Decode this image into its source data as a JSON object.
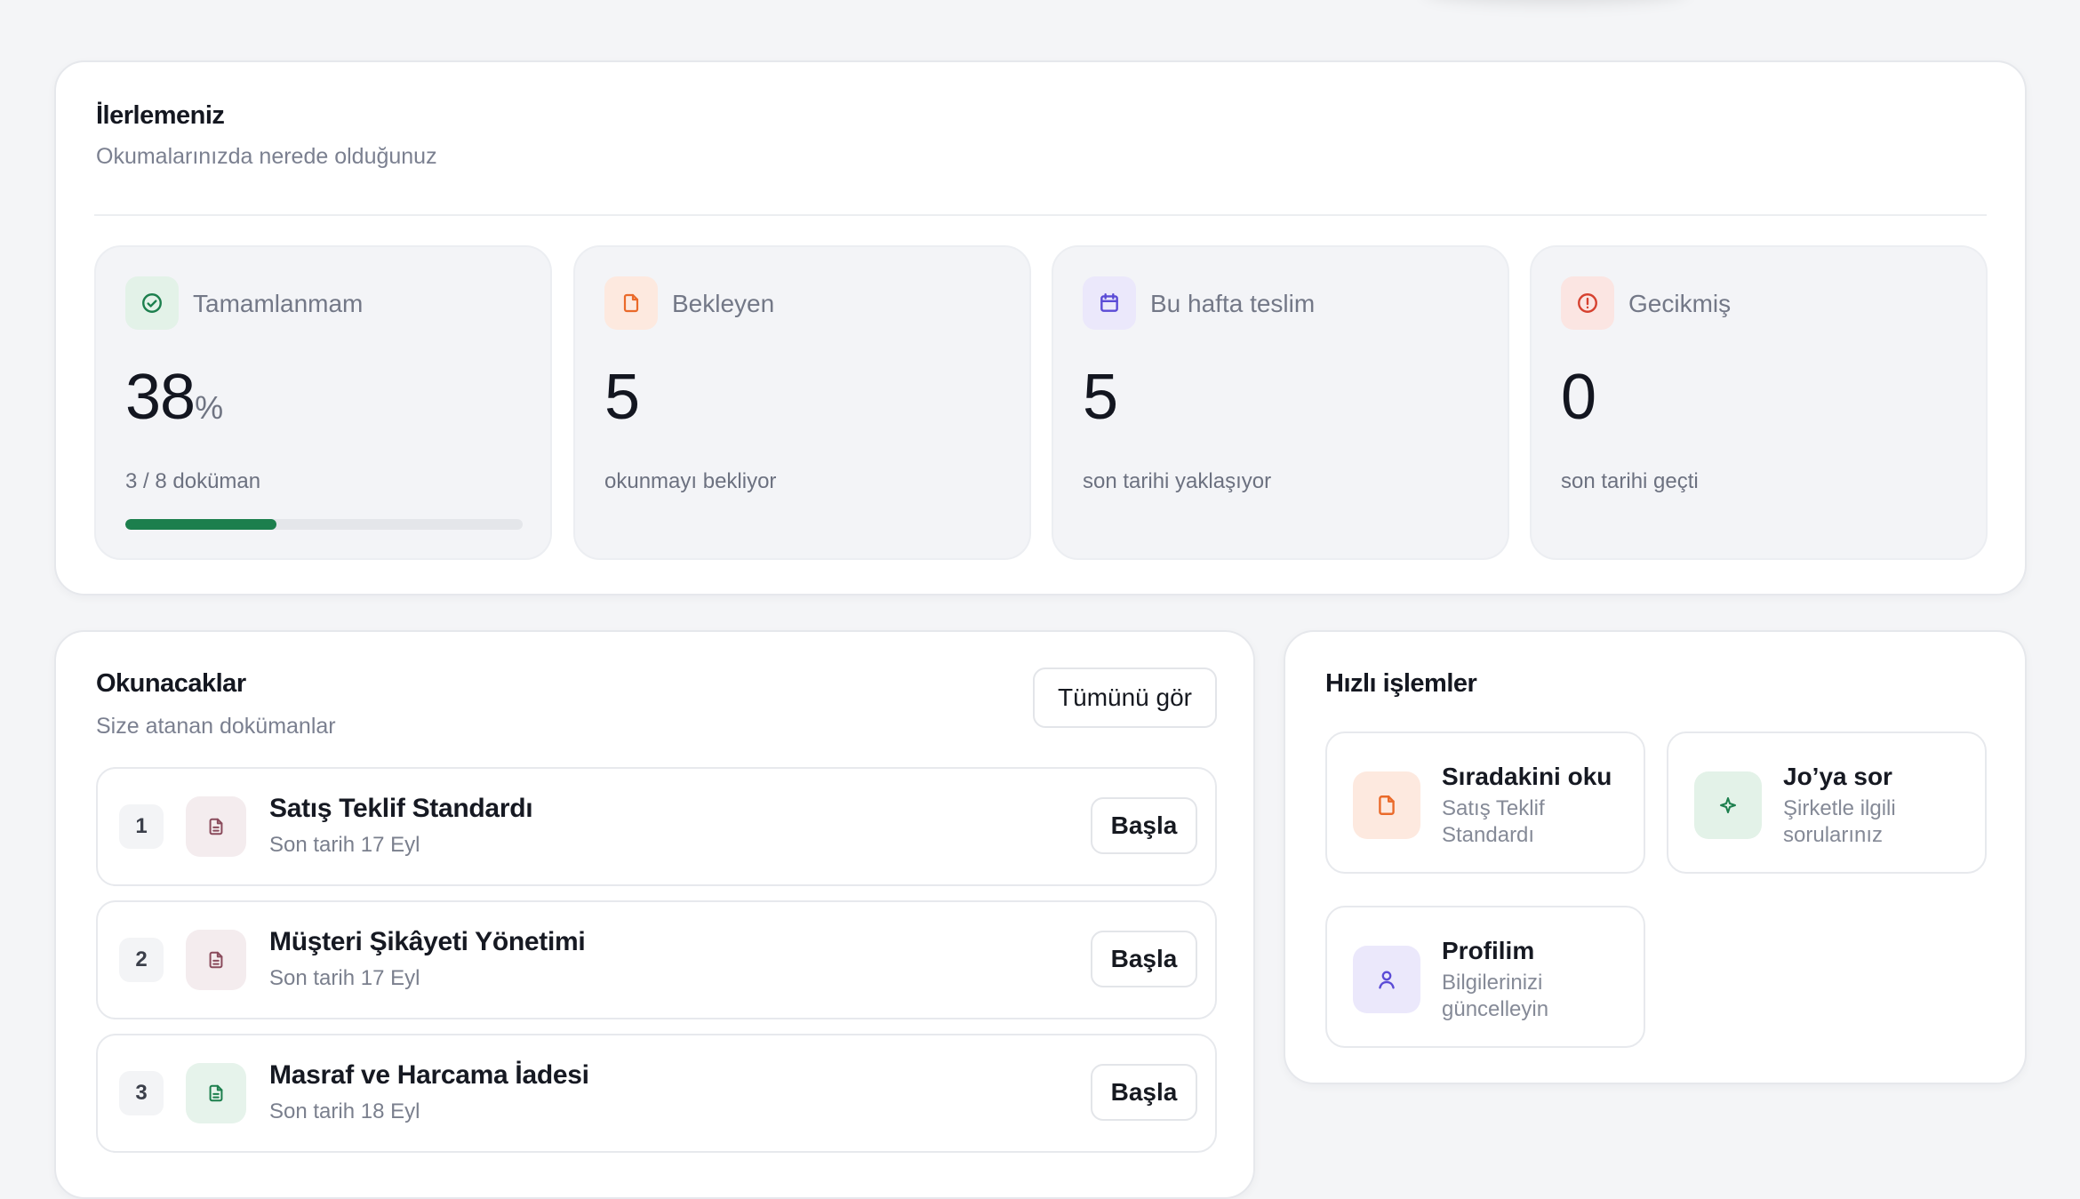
{
  "progress": {
    "title": "İlerlemeniz",
    "subtitle": "Okumalarınızda nerede olduğunuz",
    "stats": [
      {
        "label": "Tamamlanmam",
        "value": "38",
        "unit": "%",
        "note": "3 / 8 doküman",
        "icon": "check-circle-icon",
        "color": "#1c7f4d",
        "progress": 0.38
      },
      {
        "label": "Bekleyen",
        "value": "5",
        "note": "okunmayı bekliyor",
        "icon": "document-icon",
        "color": "#ea6a2a"
      },
      {
        "label": "Bu hafta teslim",
        "value": "5",
        "note": "son tarihi yaklaşıyor",
        "icon": "calendar-icon",
        "color": "#5b4bd6"
      },
      {
        "label": "Gecikmiş",
        "value": "0",
        "note": "son tarihi geçti",
        "icon": "alert-circle-icon",
        "color": "#d6412f"
      }
    ]
  },
  "reading": {
    "title": "Okunacaklar",
    "subtitle": "Size atanan dokümanlar",
    "see_all": "Tümünü gör",
    "items": [
      {
        "num": "1",
        "title": "Satış Teklif Standardı",
        "due": "Son tarih 17 Eyl",
        "action": "Başla",
        "icon": "document-text-icon",
        "color": "#8a4b5c"
      },
      {
        "num": "2",
        "title": "Müşteri Şikâyeti Yönetimi",
        "due": "Son tarih 17 Eyl",
        "action": "Başla",
        "icon": "document-text-icon",
        "color": "#8a4b5c"
      },
      {
        "num": "3",
        "title": "Masraf ve Harcama İadesi",
        "due": "Son tarih 18 Eyl",
        "action": "Başla",
        "icon": "document-text-icon",
        "color": "#1c7f4d"
      }
    ]
  },
  "actions": {
    "title": "Hızlı işlemler",
    "items": [
      {
        "title": "Sıradakini oku",
        "sub": "Satış Teklif Standardı",
        "icon": "document-icon",
        "color": "#ea6a2a"
      },
      {
        "title": "Jo’ya sor",
        "sub": "Şirketle ilgili sorularınız",
        "icon": "sparkle-icon",
        "color": "#1c7f4d"
      },
      {
        "title": "Profilim",
        "sub": "Bilgilerinizi güncelleyin",
        "icon": "user-icon",
        "color": "#5b4bd6"
      }
    ]
  }
}
